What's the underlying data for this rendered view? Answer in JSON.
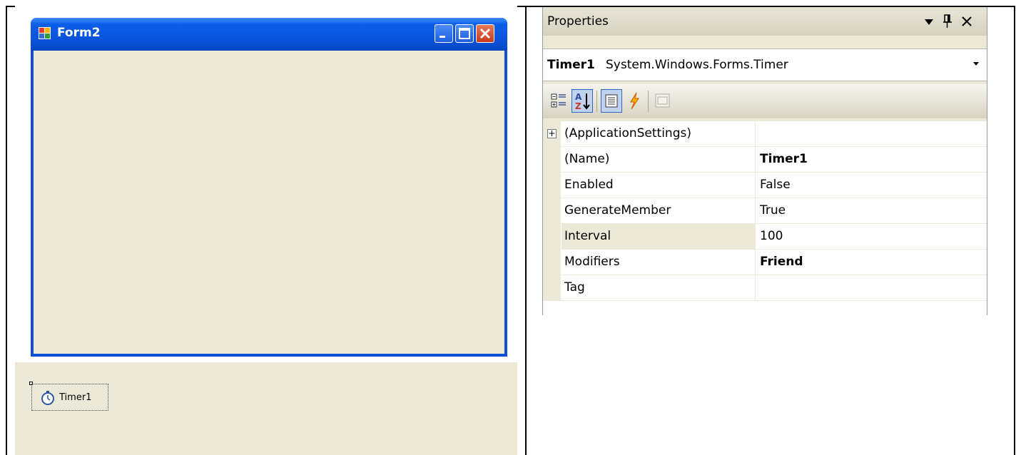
{
  "designer": {
    "form": {
      "title": "Form2",
      "buttons": [
        "minimize",
        "maximize",
        "close"
      ]
    },
    "tray": {
      "components": [
        {
          "label": "Timer1",
          "icon": "stopwatch-icon"
        }
      ]
    }
  },
  "properties": {
    "header": {
      "title": "Properties",
      "icons": [
        "dropdown-arrow-icon",
        "pin-icon",
        "close-icon"
      ]
    },
    "object_selector": {
      "name": "Timer1",
      "type": "System.Windows.Forms.Timer"
    },
    "toolbar": {
      "buttons": [
        "categorized-icon",
        "alphabetical-icon",
        "properties-icon",
        "events-icon",
        "property-pages-icon"
      ],
      "active": [
        "alphabetical-icon",
        "properties-icon"
      ]
    },
    "rows": [
      {
        "name": "(ApplicationSettings)",
        "value": "",
        "expandable": true,
        "bold": false
      },
      {
        "name": "(Name)",
        "value": "Timer1",
        "bold": true
      },
      {
        "name": "Enabled",
        "value": "False",
        "bold": false
      },
      {
        "name": "GenerateMember",
        "value": "True",
        "bold": false
      },
      {
        "name": "Interval",
        "value": "100",
        "bold": false,
        "selected": true
      },
      {
        "name": "Modifiers",
        "value": "Friend",
        "bold": true
      },
      {
        "name": "Tag",
        "value": "",
        "bold": false
      }
    ]
  },
  "colors": {
    "xp_blue": "#0A50D6",
    "control_face": "#ECE9D8",
    "selection_border": "#316AC5"
  }
}
